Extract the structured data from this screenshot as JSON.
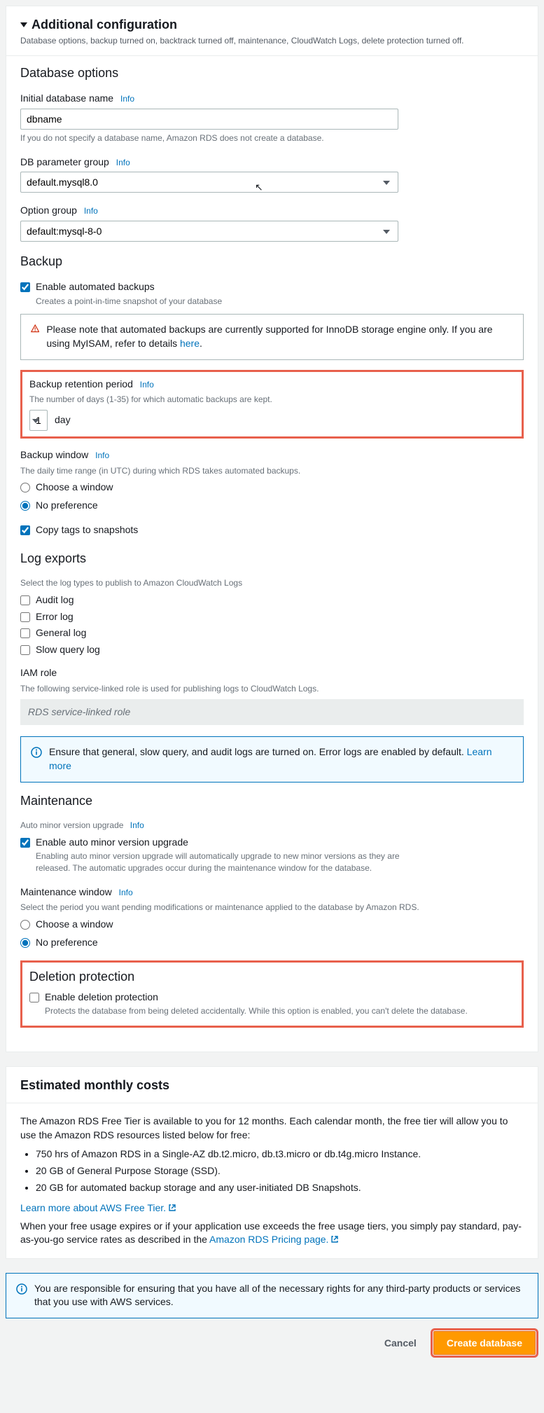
{
  "header": {
    "title": "Additional configuration",
    "subtitle": "Database options, backup turned on, backtrack turned off, maintenance, CloudWatch Logs, delete protection turned off."
  },
  "db_options": {
    "section": "Database options",
    "initial_name_label": "Initial database name",
    "initial_name_value": "dbname",
    "initial_name_hint": "If you do not specify a database name, Amazon RDS does not create a database.",
    "param_group_label": "DB parameter group",
    "param_group_value": "default.mysql8.0",
    "option_group_label": "Option group",
    "option_group_value": "default:mysql-8-0",
    "info": "Info"
  },
  "backup": {
    "section": "Backup",
    "enable_label": "Enable automated backups",
    "enable_desc": "Creates a point-in-time snapshot of your database",
    "alert_text": "Please note that automated backups are currently supported for InnoDB storage engine only. If you are using MyISAM, refer to details ",
    "alert_link": "here",
    "retention_label": "Backup retention period",
    "retention_hint": "The number of days (1-35) for which automatic backups are kept.",
    "retention_value": "1",
    "retention_unit": "day",
    "window_label": "Backup window",
    "window_hint": "The daily time range (in UTC) during which RDS takes automated backups.",
    "choose_window": "Choose a window",
    "no_pref": "No preference",
    "copy_tags": "Copy tags to snapshots",
    "info": "Info"
  },
  "logs": {
    "section": "Log exports",
    "hint": "Select the log types to publish to Amazon CloudWatch Logs",
    "items": [
      "Audit log",
      "Error log",
      "General log",
      "Slow query log"
    ],
    "iam_label": "IAM role",
    "iam_hint": "The following service-linked role is used for publishing logs to CloudWatch Logs.",
    "iam_value": "RDS service-linked role",
    "alert": "Ensure that general, slow query, and audit logs are turned on. Error logs are enabled by default. ",
    "alert_link": "Learn more"
  },
  "maint": {
    "section": "Maintenance",
    "sub_label": "Auto minor version upgrade",
    "enable_label": "Enable auto minor version upgrade",
    "enable_desc": "Enabling auto minor version upgrade will automatically upgrade to new minor versions as they are released. The automatic upgrades occur during the maintenance window for the database.",
    "window_label": "Maintenance window",
    "window_hint": "Select the period you want pending modifications or maintenance applied to the database by Amazon RDS.",
    "choose_window": "Choose a window",
    "no_pref": "No preference",
    "info": "Info"
  },
  "deletion": {
    "section": "Deletion protection",
    "enable_label": "Enable deletion protection",
    "enable_desc": "Protects the database from being deleted accidentally. While this option is enabled, you can't delete the database."
  },
  "costs": {
    "title": "Estimated monthly costs",
    "intro": "The Amazon RDS Free Tier is available to you for 12 months. Each calendar month, the free tier will allow you to use the Amazon RDS resources listed below for free:",
    "items": [
      "750 hrs of Amazon RDS in a Single-AZ db.t2.micro, db.t3.micro or db.t4g.micro Instance.",
      "20 GB of General Purpose Storage (SSD).",
      "20 GB for automated backup storage and any user-initiated DB Snapshots."
    ],
    "learn_link": "Learn more about AWS Free Tier.",
    "outro1": "When your free usage expires or if your application use exceeds the free usage tiers, you simply pay standard, pay-as-you-go service rates as described in the ",
    "outro_link": "Amazon RDS Pricing page."
  },
  "responsibility": "You are responsible for ensuring that you have all of the necessary rights for any third-party products or services that you use with AWS services.",
  "footer": {
    "cancel": "Cancel",
    "create": "Create database"
  }
}
